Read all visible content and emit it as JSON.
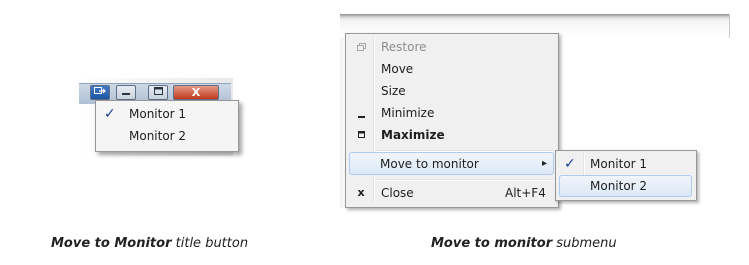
{
  "left_panel": {
    "caption_bold": "Move to Monitor",
    "caption_rest": "title button",
    "monitor_menu": [
      {
        "label": "Monitor 1",
        "checked": true
      },
      {
        "label": "Monitor 2",
        "checked": false
      }
    ],
    "close_glyph": "X"
  },
  "right_panel": {
    "caption_bold": "Move to monitor",
    "caption_rest": "submenu",
    "system_menu": [
      {
        "label": "Restore",
        "disabled": true,
        "icon": "restore-icon"
      },
      {
        "label": "Move"
      },
      {
        "label": "Size"
      },
      {
        "label": "Minimize",
        "icon": "minimize-icon"
      },
      {
        "label": "Maximize",
        "bold": true,
        "icon": "maximize-icon"
      },
      {
        "label": "Move to monitor",
        "highlighted": true,
        "has_submenu": true
      },
      {
        "label": "Close",
        "shortcut": "Alt+F4",
        "icon": "close-icon"
      }
    ],
    "close_glyph": "x",
    "submenu": [
      {
        "label": "Monitor 1",
        "checked": true
      },
      {
        "label": "Monitor 2",
        "highlighted": true
      }
    ]
  },
  "glyphs": {
    "check": "✓",
    "arrow": "▸"
  },
  "colors": {
    "highlight_border": "#aecbf0",
    "menu_bg": "#f0f0f0",
    "check": "#1c3f8f",
    "close_button": "#c1391e"
  }
}
